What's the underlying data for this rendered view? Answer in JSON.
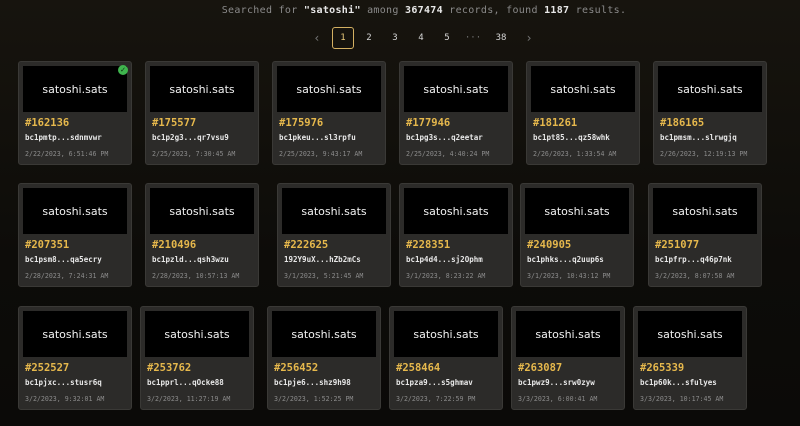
{
  "search": {
    "prefix": "Searched for ",
    "query": "\"satoshi\"",
    "among": " among ",
    "records": "367474",
    "records_suffix": " records, found ",
    "results": "1187",
    "results_suffix": " results."
  },
  "pagination": {
    "prev": "‹",
    "pages": [
      "1",
      "2",
      "3",
      "4",
      "5"
    ],
    "ellipsis": "···",
    "last": "38",
    "next": "›",
    "active": "1"
  },
  "colors": {
    "accent": "#e6b84c",
    "active_border": "#d4b062",
    "verified": "#3fb54e"
  },
  "icons": {
    "verified": "check-circle-icon"
  },
  "cards": [
    {
      "name": "satoshi.sats",
      "number": "#162136",
      "address": "bc1pmtp...sdnmvwr",
      "date": "2/22/2023, 6:51:46 PM",
      "verified": true
    },
    {
      "name": "satoshi.sats",
      "number": "#175577",
      "address": "bc1p2g3...qr7vsu9",
      "date": "2/25/2023, 7:30:45 AM"
    },
    {
      "name": "satoshi.sats",
      "number": "#175976",
      "address": "bc1pkeu...sl3rpfu",
      "date": "2/25/2023, 9:43:17 AM"
    },
    {
      "name": "satoshi.sats",
      "number": "#177946",
      "address": "bc1pg3s...q2eetar",
      "date": "2/25/2023, 4:40:24 PM"
    },
    {
      "name": "satoshi.sats",
      "number": "#181261",
      "address": "bc1pt85...qz58whk",
      "date": "2/26/2023, 1:33:54 AM"
    },
    {
      "name": "satoshi.sats",
      "number": "#186165",
      "address": "bc1pmsm...slrwgjq",
      "date": "2/26/2023, 12:19:13 PM"
    },
    {
      "name": "satoshi.sats",
      "number": "#207351",
      "address": "bc1psm8...qa5ecry",
      "date": "2/28/2023, 7:24:31 AM"
    },
    {
      "name": "satoshi.sats",
      "number": "#210496",
      "address": "bc1pzld...qsh3wzu",
      "date": "2/28/2023, 10:57:13 AM"
    },
    {
      "name": "satoshi.sats",
      "number": "#222625",
      "address": "192Y9uX...hZb2mCs",
      "date": "3/1/2023, 5:21:45 AM"
    },
    {
      "name": "satoshi.sats",
      "number": "#228351",
      "address": "bc1p4d4...sj2Ophm",
      "date": "3/1/2023, 8:23:22 AM"
    },
    {
      "name": "satoshi.sats",
      "number": "#240905",
      "address": "bc1phks...q2uup6s",
      "date": "3/1/2023, 10:43:12 PM"
    },
    {
      "name": "satoshi.sats",
      "number": "#251077",
      "address": "bc1pfrp...q46p7nk",
      "date": "3/2/2023, 8:07:58 AM"
    },
    {
      "name": "satoshi.sats",
      "number": "#252527",
      "address": "bc1pjxc...stusr6q",
      "date": "3/2/2023, 9:32:01 AM"
    },
    {
      "name": "satoshi.sats",
      "number": "#253762",
      "address": "bc1pprl...qOcke88",
      "date": "3/2/2023, 11:27:19 AM"
    },
    {
      "name": "satoshi.sats",
      "number": "#256452",
      "address": "bc1pje6...shz9h98",
      "date": "3/2/2023, 1:52:25 PM"
    },
    {
      "name": "satoshi.sats",
      "number": "#258464",
      "address": "bc1pza9...s5ghmav",
      "date": "3/2/2023, 7:22:59 PM"
    },
    {
      "name": "satoshi.sats",
      "number": "#263087",
      "address": "bc1pwz9...srw0zyw",
      "date": "3/3/2023, 6:00:41 AM"
    },
    {
      "name": "satoshi.sats",
      "number": "#265339",
      "address": "bc1p60k...sfulyes",
      "date": "3/3/2023, 10:17:45 AM"
    }
  ]
}
